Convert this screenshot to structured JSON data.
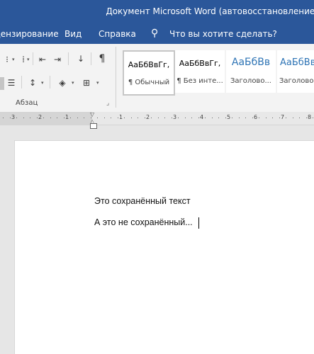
{
  "window": {
    "title": "Документ Microsoft Word (автовосстановление)"
  },
  "tabs": [
    {
      "label": "Рецензирование"
    },
    {
      "label": "Вид"
    },
    {
      "label": "Справка"
    }
  ],
  "tell_me": {
    "label": "Что вы хотите сделать?",
    "icon": "lightbulb-icon"
  },
  "ribbon": {
    "paragraph_group": {
      "label": "Абзац"
    },
    "styles": [
      {
        "sample": "АаБбВвГг,",
        "name": "¶ Обычный",
        "selected": true
      },
      {
        "sample": "АаБбВвГг,",
        "name": "¶ Без инте..."
      },
      {
        "sample": "АаБбВв",
        "name": "Заголово..."
      },
      {
        "sample": "АаБбВв",
        "name": "Заголово..."
      }
    ]
  },
  "ruler": {
    "numbers": [
      "3",
      "2",
      "1",
      "1",
      "2",
      "3",
      "4",
      "5",
      "6",
      "7",
      "8"
    ]
  },
  "document": {
    "lines": [
      "Это сохранённый текст",
      "А это не сохранённый..."
    ]
  },
  "colors": {
    "accent": "#2b579a",
    "ribbon_bg": "#f3f3f3",
    "page_bg": "#ffffff",
    "canvas_bg": "#e6e6e6"
  }
}
